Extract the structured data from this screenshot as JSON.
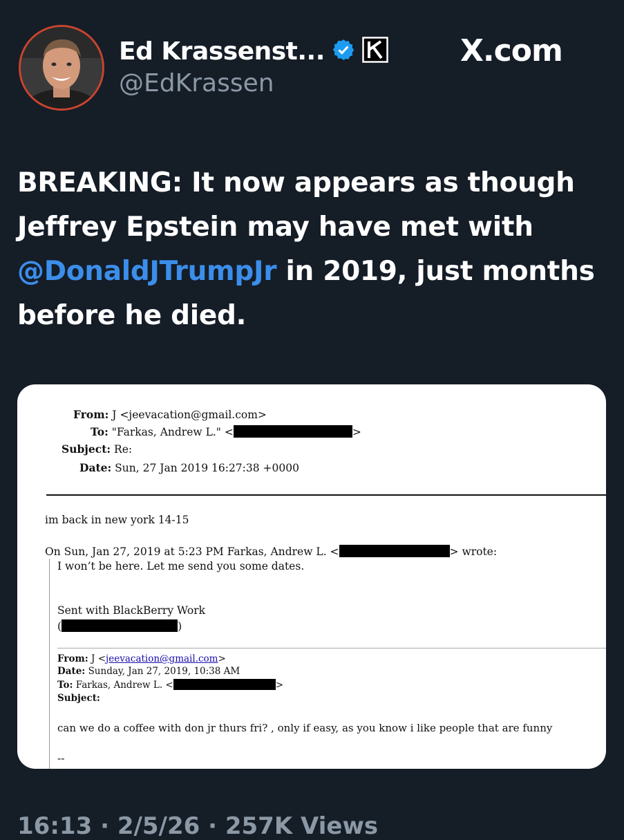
{
  "header": {
    "display_name": "Ed Krassenst...",
    "handle": "@EdKrassen",
    "site": "X.com",
    "verified_icon": "verified-badge-icon",
    "affiliate_icon": "k-affiliate-badge-icon"
  },
  "tweet": {
    "text_part1": "BREAKING: It now appears as though Jeffrey Epstein may have met with ",
    "mention": "@DonaldJTrumpJr",
    "text_part2": " in 2019, just months before he died."
  },
  "email": {
    "from_label": "From:",
    "from_value": "J <jeevacation@gmail.com>",
    "to_label": "To:",
    "to_value": "\"Farkas, Andrew L.\" <",
    "subject_label": "Subject:",
    "subject_value": "Re:",
    "date_label": "Date:",
    "date_value": "Sun, 27 Jan 2019 16:27:38 +0000",
    "body_line": "im back in new york 14-15",
    "reply_intro": "On Sun, Jan 27, 2019 at 5:23 PM Farkas, Andrew L. <",
    "reply_wrote": "> wrote:",
    "reply_body": "I won’t be here. Let me send you some dates.",
    "sent_with": "Sent with BlackBerry Work",
    "orig_from_label": "From:",
    "orig_from_name": "J <",
    "orig_from_email": "jeevacation@gmail.com",
    "orig_from_close": ">",
    "orig_date_label": "Date:",
    "orig_date_value": "Sunday, Jan 27, 2019, 10:38 AM",
    "orig_to_label": "To:",
    "orig_to_value": "Farkas, Andrew L. <",
    "orig_subject_label": "Subject:",
    "orig_body": "can we do a coffee with don jr   thurs fri?    , only if easy,  as you know i like people that are funny",
    "trailing": "--"
  },
  "footer": {
    "meta": "16:13 · 2/5/26 · 257K Views"
  },
  "colors": {
    "background": "#151d27",
    "mention": "#3b8eea",
    "verified": "#1d9bf0",
    "muted": "#8b98a5",
    "avatar_ring": "#c9442e"
  }
}
